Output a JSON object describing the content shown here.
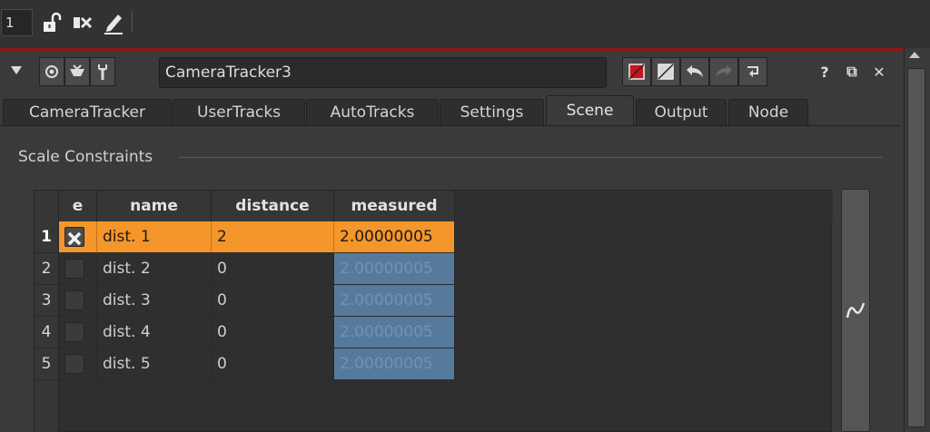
{
  "toolbar": {
    "viewer_number": "1",
    "icons": [
      "unlock-icon",
      "clear-icon",
      "edit-pencil-icon"
    ]
  },
  "panel": {
    "node_name": "CameraTracker3",
    "header_buttons": [
      "viewer-toggle-icon",
      "node-input-icon",
      "wrench-icon"
    ],
    "right_buttons": [
      "red-color-swatch-icon",
      "gray-color-swatch-icon",
      "undo-icon",
      "redo-icon",
      "revert-icon"
    ],
    "window_icons": {
      "help": "?",
      "float": "⧉",
      "close": "✕"
    }
  },
  "tabs": [
    {
      "label": "CameraTracker",
      "active": false
    },
    {
      "label": "UserTracks",
      "active": false
    },
    {
      "label": "AutoTracks",
      "active": false
    },
    {
      "label": "Settings",
      "active": false
    },
    {
      "label": "Scene",
      "active": true
    },
    {
      "label": "Output",
      "active": false
    },
    {
      "label": "Node",
      "active": false
    }
  ],
  "section": {
    "title": "Scale Constraints"
  },
  "table": {
    "columns": [
      "e",
      "name",
      "distance",
      "measured"
    ],
    "rows": [
      {
        "index": "1",
        "enabled": true,
        "name": "dist. 1",
        "distance": "2",
        "measured": "2.00000005",
        "selected": true
      },
      {
        "index": "2",
        "enabled": false,
        "name": "dist. 2",
        "distance": "0",
        "measured": "2.00000005",
        "selected": false
      },
      {
        "index": "3",
        "enabled": false,
        "name": "dist. 3",
        "distance": "0",
        "measured": "2.00000005",
        "selected": false
      },
      {
        "index": "4",
        "enabled": false,
        "name": "dist. 4",
        "distance": "0",
        "measured": "2.00000005",
        "selected": false
      },
      {
        "index": "5",
        "enabled": false,
        "name": "dist. 5",
        "distance": "0",
        "measured": "2.00000005",
        "selected": false
      }
    ]
  },
  "colors": {
    "selection": "#f4962a",
    "measured_readonly": "#567a9c",
    "accent_line": "#8a1a18"
  }
}
